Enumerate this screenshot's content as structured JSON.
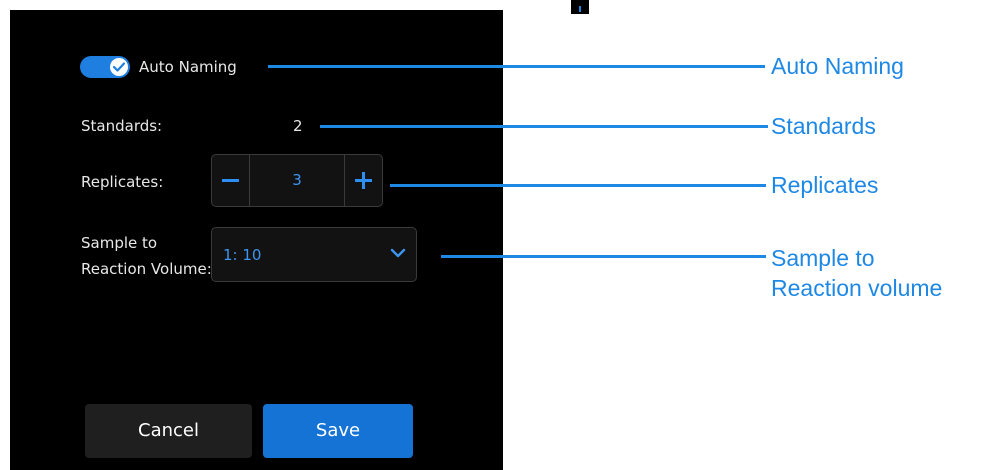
{
  "dialog": {
    "auto_naming": {
      "label": "Auto Naming",
      "enabled": true
    },
    "standards": {
      "label": "Standards:",
      "value": "2"
    },
    "replicates": {
      "label": "Replicates:",
      "value": "3"
    },
    "sample_volume": {
      "label_line1": "Sample to",
      "label_line2": "Reaction Volume:",
      "selected": "1: 10"
    },
    "cancel_label": "Cancel",
    "save_label": "Save"
  },
  "callouts": {
    "auto_naming": "Auto Naming",
    "standards": "Standards",
    "replicates": "Replicates",
    "sample_line1": "Sample to",
    "sample_line2": "Reaction volume"
  },
  "colors": {
    "accent": "#1e88e5",
    "panel_bg": "#000000",
    "save_bg": "#1573d6"
  },
  "icons": {
    "toggle_check": "check-icon",
    "stepper_minus": "minus-icon",
    "stepper_plus": "plus-icon",
    "select_chevron": "chevron-down-icon"
  }
}
